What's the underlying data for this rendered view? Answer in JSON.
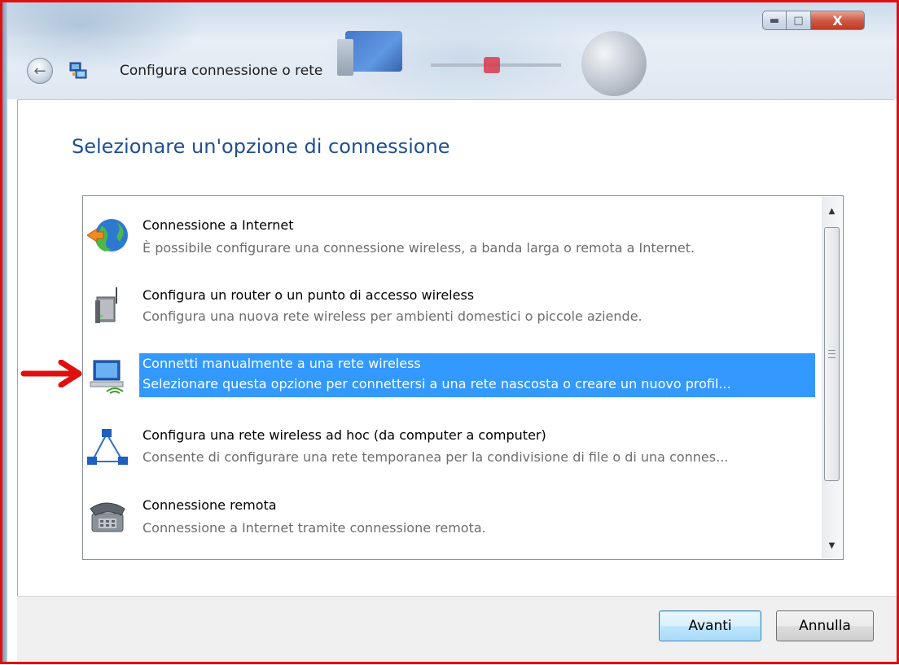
{
  "window": {
    "title": "Configura connessione o rete",
    "controls": {
      "minimize_icon": "minimize-icon",
      "maximize_icon": "maximize-icon",
      "close_label": "X"
    }
  },
  "heading": "Selezionare un'opzione di connessione",
  "options": [
    {
      "title": "Connessione a Internet",
      "description": "È possibile configurare una connessione wireless, a banda larga o remota a Internet.",
      "icon": "internet-globe-icon"
    },
    {
      "title": "Configura un router o un punto di accesso wireless",
      "description": "Configura una nuova rete wireless per ambienti domestici o piccole aziende.",
      "icon": "router-icon"
    },
    {
      "title": "Connetti manualmente a una rete wireless",
      "description": "Selezionare questa opzione per connettersi a una rete nascosta o creare un nuovo profil...",
      "icon": "wireless-network-icon",
      "selected": true
    },
    {
      "title": "Configura una rete wireless ad hoc (da computer a computer)",
      "description": "Consente di configurare una rete temporanea per la condivisione di file o di una connes...",
      "icon": "adhoc-network-icon"
    },
    {
      "title": "Connessione remota",
      "description": "Connessione a Internet tramite connessione remota.",
      "icon": "dialup-phone-icon"
    }
  ],
  "buttons": {
    "next": "Avanti",
    "cancel": "Annulla"
  },
  "colors": {
    "selection": "#3399ff",
    "heading": "#1f4f92",
    "annotation_arrow": "#e01010"
  }
}
